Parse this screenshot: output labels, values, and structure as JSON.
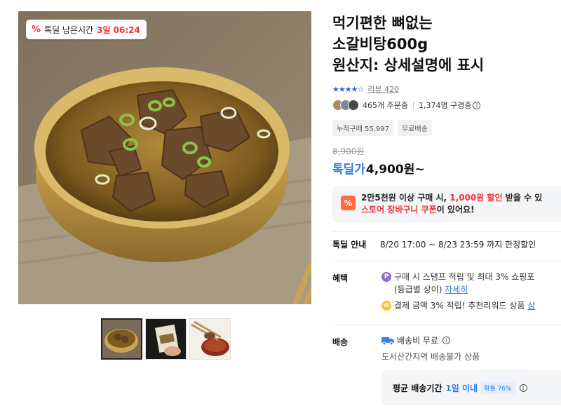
{
  "deal_badge": {
    "icon": "percent-icon",
    "label": "톡딜 남은시간",
    "time": "3일 06:24"
  },
  "gallery": {
    "thumbnails": [
      "soup-bowl",
      "package-hand",
      "dipping-sauce"
    ]
  },
  "product": {
    "title_lines": [
      "먹기편한 뼈없는",
      "소갈비탕600g",
      "원산지: 상세설명에 표시"
    ],
    "rating_stars": 4.5,
    "review_label": "리뷰 420",
    "ordering": "465개 주문중",
    "subscribers": "1,374명 구경중",
    "tags": [
      "누적구매 55,997",
      "무료배송"
    ],
    "original_price": "8,900원",
    "deal_label": "톡딜가",
    "deal_price": "4,900원~"
  },
  "coupon": {
    "icon": "%",
    "line1_pre": "2만5천원 이상 구매 시, ",
    "line1_highlight": "1,000원 할인",
    "line1_post": " 받을 수 있",
    "line2_highlight": "스토어 장바구니 쿠폰",
    "line2_post": "이 있어요!"
  },
  "deal_info": {
    "label": "톡딜 안내",
    "value": "8/20 17:00 ~ 8/23 23:59 까지 한정할인"
  },
  "benefits": {
    "label": "혜택",
    "item1_icon": "P",
    "item1_line1": "구매 시 스탬프 적립 및 최대 3% 쇼핑포",
    "item1_line2_pre": "(등급별 상이) ",
    "item1_link": "자세히",
    "item2_icon": "W",
    "item2_pre": "결제 금액 3% 적립! 추천리워드 상품 ",
    "item2_link": "상"
  },
  "shipping": {
    "label": "배송",
    "fee": "배송비 무료",
    "note": "도서산간지역 배송불가 상품",
    "avg_label": "평균 배송기간",
    "avg_value": "1일 이내",
    "probability": "확률 76%"
  },
  "colors": {
    "accent_blue": "#2b7ce3",
    "accent_red": "#f0333a",
    "coupon_orange": "#ff6b3d"
  }
}
